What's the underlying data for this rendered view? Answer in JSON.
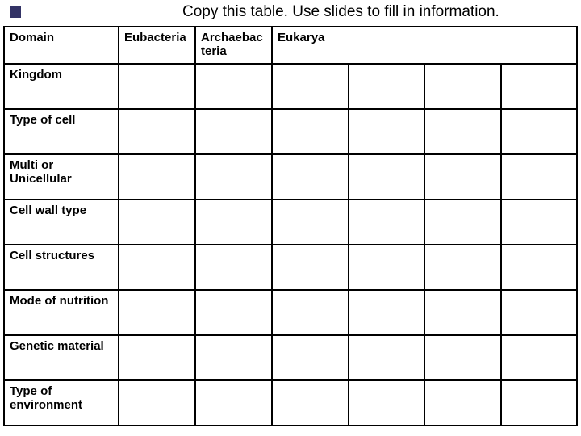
{
  "title": "Copy this table.  Use slides to fill in information.",
  "header": {
    "domain": "Domain",
    "eubacteria": "Eubacteria",
    "archaebacteria": "Archaebac teria",
    "eukarya": "Eukarya"
  },
  "rows": {
    "kingdom": "Kingdom",
    "type_of_cell": "Type of cell",
    "multi_uni": "Multi or Unicellular",
    "cell_wall": "Cell wall type",
    "cell_structures": "Cell structures",
    "mode_nutrition": "Mode of nutrition",
    "genetic_material": "Genetic material",
    "type_env": "Type of environment"
  }
}
